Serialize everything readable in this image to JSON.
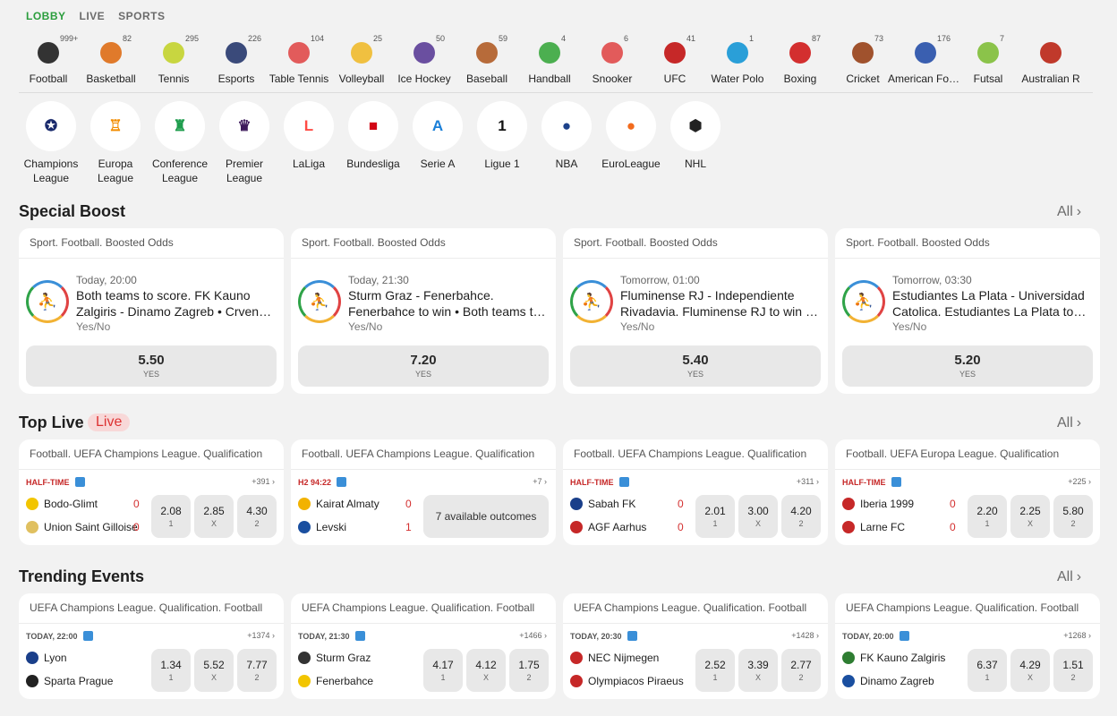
{
  "tabs": [
    "LOBBY",
    "LIVE",
    "SPORTS"
  ],
  "sports": [
    {
      "name": "Football",
      "count": "999+",
      "icon": "football-icon",
      "color": "#333333"
    },
    {
      "name": "Basketball",
      "count": "82",
      "icon": "basketball-icon",
      "color": "#e07a2b"
    },
    {
      "name": "Tennis",
      "count": "295",
      "icon": "tennis-icon",
      "color": "#c8d640"
    },
    {
      "name": "Esports",
      "count": "226",
      "icon": "headset-icon",
      "color": "#3a4a7a"
    },
    {
      "name": "Table Tennis",
      "count": "104",
      "icon": "table-tennis-icon",
      "color": "#e25b5b"
    },
    {
      "name": "Volleyball",
      "count": "25",
      "icon": "volleyball-icon",
      "color": "#f0c040"
    },
    {
      "name": "Ice Hockey",
      "count": "50",
      "icon": "ice-hockey-icon",
      "color": "#6a4fa0"
    },
    {
      "name": "Baseball",
      "count": "59",
      "icon": "baseball-icon",
      "color": "#b76b3a"
    },
    {
      "name": "Handball",
      "count": "4",
      "icon": "handball-icon",
      "color": "#4caf50"
    },
    {
      "name": "Snooker",
      "count": "6",
      "icon": "snooker-icon",
      "color": "#e25b5b"
    },
    {
      "name": "UFC",
      "count": "41",
      "icon": "ufc-glove-icon",
      "color": "#c62828"
    },
    {
      "name": "Water Polo",
      "count": "1",
      "icon": "water-polo-icon",
      "color": "#2a9fd8"
    },
    {
      "name": "Boxing",
      "count": "87",
      "icon": "boxing-glove-icon",
      "color": "#d32f2f"
    },
    {
      "name": "Cricket",
      "count": "73",
      "icon": "cricket-icon",
      "color": "#a0522d"
    },
    {
      "name": "American Foot...",
      "count": "176",
      "icon": "american-football-helmet-icon",
      "color": "#3a5fb0"
    },
    {
      "name": "Futsal",
      "count": "7",
      "icon": "futsal-icon",
      "color": "#8bc34a"
    },
    {
      "name": "Australian R",
      "count": "",
      "icon": "australian-rules-icon",
      "color": "#c0392b"
    }
  ],
  "leagues": [
    {
      "name": "Champions League",
      "icon": "champions-league-icon",
      "glyph": "✪",
      "color": "#1a2a6c"
    },
    {
      "name": "Europa League",
      "icon": "europa-league-icon",
      "glyph": "♖",
      "color": "#f28c00"
    },
    {
      "name": "Conference League",
      "icon": "conference-league-icon",
      "glyph": "♜",
      "color": "#1f9d4d"
    },
    {
      "name": "Premier League",
      "icon": "premier-league-icon",
      "glyph": "♛",
      "color": "#3d195b"
    },
    {
      "name": "LaLiga",
      "icon": "laliga-icon",
      "glyph": "L",
      "color": "#ff4b44"
    },
    {
      "name": "Bundesliga",
      "icon": "bundesliga-icon",
      "glyph": "■",
      "color": "#d20515"
    },
    {
      "name": "Serie A",
      "icon": "serie-a-icon",
      "glyph": "A",
      "color": "#1a7fd8"
    },
    {
      "name": "Ligue 1",
      "icon": "ligue-1-icon",
      "glyph": "1",
      "color": "#111111"
    },
    {
      "name": "NBA",
      "icon": "nba-icon",
      "glyph": "●",
      "color": "#1d428a"
    },
    {
      "name": "EuroLeague",
      "icon": "euroleague-icon",
      "glyph": "●",
      "color": "#f26b1d"
    },
    {
      "name": "NHL",
      "icon": "nhl-icon",
      "glyph": "⬢",
      "color": "#222222"
    }
  ],
  "sections": {
    "boost": "Special Boost",
    "live": "Top Live",
    "live_badge": "Live",
    "trending": "Trending Events",
    "all": "All",
    "chevron": "›"
  },
  "boosts": [
    {
      "header": "Sport. Football. Boosted Odds",
      "time": "Today, 20:00",
      "desc": "Both teams to score. FK Kauno Zalgiris - Dinamo Zagreb • Crvena zvezda",
      "market": "Yes/No",
      "odd": "5.50",
      "label": "YES"
    },
    {
      "header": "Sport. Football. Boosted Odds",
      "time": "Today, 21:30",
      "desc": "Sturm Graz - Fenerbahce. Fenerbahce to win • Both teams to score",
      "market": "Yes/No",
      "odd": "7.20",
      "label": "YES"
    },
    {
      "header": "Sport. Football. Boosted Odds",
      "time": "Tomorrow, 01:00",
      "desc": "Fluminense RJ - Independiente Rivadavia. Fluminense RJ to win • Over",
      "market": "Yes/No",
      "odd": "5.40",
      "label": "YES"
    },
    {
      "header": "Sport. Football. Boosted Odds",
      "time": "Tomorrow, 03:30",
      "desc": "Estudiantes La Plata - Universidad Catolica. Estudiantes La Plata to win",
      "market": "Yes/No",
      "odd": "5.20",
      "label": "YES"
    }
  ],
  "live": [
    {
      "header": "Football. UEFA Champions League. Qualification",
      "status": "HALF-TIME",
      "more": "+391 ›",
      "home": "Bodo-Glimt",
      "away": "Union Saint Gilloise",
      "hs": "0",
      "as": "0",
      "homeColor": "#f2c500",
      "awayColor": "#e0c060",
      "odds": [
        {
          "v": "2.08",
          "l": "1"
        },
        {
          "v": "2.85",
          "l": "X"
        },
        {
          "v": "4.30",
          "l": "2"
        }
      ]
    },
    {
      "header": "Football. UEFA Champions League. Qualification",
      "status": "H2 94:22",
      "more": "+7 ›",
      "home": "Kairat Almaty",
      "away": "Levski",
      "hs": "0",
      "as": "1",
      "homeColor": "#f2b200",
      "awayColor": "#1a4fa0",
      "outcomes": "7 available outcomes"
    },
    {
      "header": "Football. UEFA Champions League. Qualification",
      "status": "HALF-TIME",
      "more": "+311 ›",
      "home": "Sabah FK",
      "away": "AGF Aarhus",
      "hs": "0",
      "as": "0",
      "homeColor": "#1a3f8a",
      "awayColor": "#c62828",
      "odds": [
        {
          "v": "2.01",
          "l": "1"
        },
        {
          "v": "3.00",
          "l": "X"
        },
        {
          "v": "4.20",
          "l": "2"
        }
      ]
    },
    {
      "header": "Football. UEFA Europa League. Qualification",
      "status": "HALF-TIME",
      "more": "+225 ›",
      "home": "Iberia 1999",
      "away": "Larne FC",
      "hs": "0",
      "as": "0",
      "homeColor": "#c62828",
      "awayColor": "#c62828",
      "odds": [
        {
          "v": "2.20",
          "l": "1"
        },
        {
          "v": "2.25",
          "l": "X"
        },
        {
          "v": "5.80",
          "l": "2"
        }
      ]
    }
  ],
  "trending": [
    {
      "header": "UEFA Champions League. Qualification. Football",
      "status": "TODAY, 22:00",
      "more": "+1374 ›",
      "home": "Lyon",
      "away": "Sparta Prague",
      "homeColor": "#1a3f8a",
      "awayColor": "#222222",
      "odds": [
        {
          "v": "1.34",
          "l": "1"
        },
        {
          "v": "5.52",
          "l": "X"
        },
        {
          "v": "7.77",
          "l": "2"
        }
      ]
    },
    {
      "header": "UEFA Champions League. Qualification. Football",
      "status": "TODAY, 21:30",
      "more": "+1466 ›",
      "home": "Sturm Graz",
      "away": "Fenerbahce",
      "homeColor": "#333333",
      "awayColor": "#f2c500",
      "odds": [
        {
          "v": "4.17",
          "l": "1"
        },
        {
          "v": "4.12",
          "l": "X"
        },
        {
          "v": "1.75",
          "l": "2"
        }
      ]
    },
    {
      "header": "UEFA Champions League. Qualification. Football",
      "status": "TODAY, 20:30",
      "more": "+1428 ›",
      "home": "NEC Nijmegen",
      "away": "Olympiacos Piraeus",
      "homeColor": "#c62828",
      "awayColor": "#c62828",
      "odds": [
        {
          "v": "2.52",
          "l": "1"
        },
        {
          "v": "3.39",
          "l": "X"
        },
        {
          "v": "2.77",
          "l": "2"
        }
      ]
    },
    {
      "header": "UEFA Champions League. Qualification. Football",
      "status": "TODAY, 20:00",
      "more": "+1268 ›",
      "home": "FK Kauno Zalgiris",
      "away": "Dinamo Zagreb",
      "homeColor": "#2e7d32",
      "awayColor": "#1a4fa0",
      "odds": [
        {
          "v": "6.37",
          "l": "1"
        },
        {
          "v": "4.29",
          "l": "X"
        },
        {
          "v": "1.51",
          "l": "2"
        }
      ]
    }
  ]
}
